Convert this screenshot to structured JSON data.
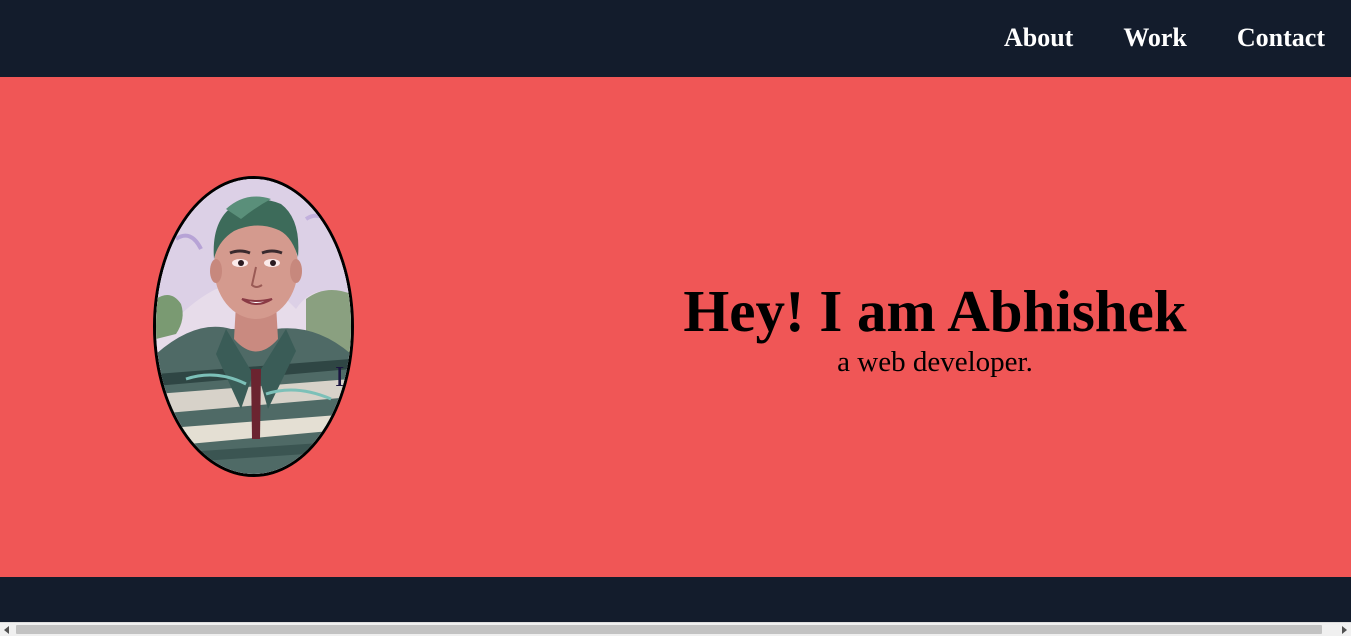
{
  "nav": {
    "items": [
      {
        "label": "About"
      },
      {
        "label": "Work"
      },
      {
        "label": "Contact"
      }
    ]
  },
  "hero": {
    "headline": "Hey! I am Abhishek",
    "subline": "a web developer.",
    "stray_glyph": "I"
  },
  "colors": {
    "navbar_bg": "#131c2c",
    "hero_bg": "#f05656",
    "nav_text": "#ffffff",
    "headline_text": "#000000"
  },
  "icons": {
    "portrait": "profile-photo",
    "scroll_left": "chevron-left-icon",
    "scroll_right": "chevron-right-icon"
  }
}
